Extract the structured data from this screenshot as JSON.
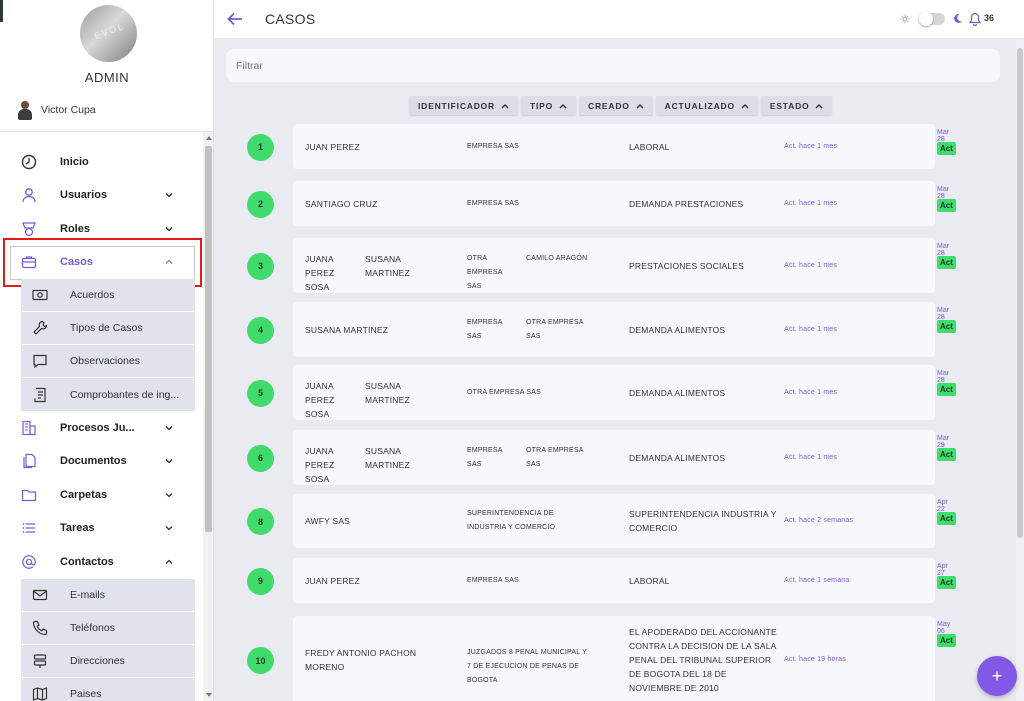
{
  "sidebar": {
    "role": "ADMIN",
    "avatar_text": "EVOL",
    "user_name": "Victor Cupa",
    "items": [
      {
        "label": "Inicio"
      },
      {
        "label": "Usuarios"
      },
      {
        "label": "Roles"
      },
      {
        "label": "Casos"
      },
      {
        "label": "Procesos Ju..."
      },
      {
        "label": "Documentos"
      },
      {
        "label": "Carpetas"
      },
      {
        "label": "Tareas"
      },
      {
        "label": "Contactos"
      }
    ],
    "casos_sub": [
      {
        "label": "Acuerdos"
      },
      {
        "label": "Tipos de Casos"
      },
      {
        "label": "Observaciones"
      },
      {
        "label": "Comprobantes de ing..."
      }
    ],
    "contactos_sub": [
      {
        "label": "E-mails"
      },
      {
        "label": "Teléfonos"
      },
      {
        "label": "Direcciones"
      },
      {
        "label": "Paises"
      }
    ]
  },
  "header": {
    "title": "CASOS",
    "notifications": "36"
  },
  "filter": {
    "placeholder": "Filtrar"
  },
  "sort": [
    {
      "label": "IDENTIFICADOR"
    },
    {
      "label": "TIPO"
    },
    {
      "label": "CREADO"
    },
    {
      "label": "ACTUALIZADO"
    },
    {
      "label": "ESTADO"
    }
  ],
  "cases": [
    {
      "num": "1",
      "names": [
        "JUAN PEREZ"
      ],
      "types": [
        "EMPRESA SAS"
      ],
      "desc": "LABORAL",
      "updated": "Act. hace 1 mes",
      "date": "Mar 28",
      "status": "Act"
    },
    {
      "num": "2",
      "names": [
        "SANTIAGO CRUZ"
      ],
      "types": [
        "EMPRESA SAS"
      ],
      "desc": "DEMANDA PRESTACIONES",
      "updated": "Act. hace 1 mes",
      "date": "Mar 28",
      "status": "Act"
    },
    {
      "num": "3",
      "names": [
        "JUANA PEREZ SOSA",
        "SUSANA MARTINEZ"
      ],
      "types": [
        "OTRA EMPRESA SAS",
        "CAMILO ARAGÓN"
      ],
      "desc": "PRESTACIONES SOCIALES",
      "updated": "Act. hace 1 mes",
      "date": "Mar 28",
      "status": "Act"
    },
    {
      "num": "4",
      "names": [
        "SUSANA MARTINEZ"
      ],
      "types": [
        "EMPRESA SAS",
        "OTRA EMPRESA SAS"
      ],
      "desc": "DEMANDA ALIMENTOS",
      "updated": "Act. hace 1 mes",
      "date": "Mar 28",
      "status": "Act"
    },
    {
      "num": "5",
      "names": [
        "JUANA PEREZ SOSA",
        "SUSANA MARTINEZ"
      ],
      "types": [
        "OTRA EMPRESA SAS"
      ],
      "desc": "DEMANDA ALIMENTOS",
      "updated": "Act. hace 1 mes",
      "date": "Mar 28",
      "status": "Act"
    },
    {
      "num": "6",
      "names": [
        "JUANA PEREZ SOSA",
        "SUSANA MARTINEZ"
      ],
      "types": [
        "EMPRESA SAS",
        "OTRA EMPRESA SAS"
      ],
      "desc": "DEMANDA ALIMENTOS",
      "updated": "Act. hace 1 mes",
      "date": "Mar 29",
      "status": "Act"
    },
    {
      "num": "8",
      "names": [
        "AWFY SAS"
      ],
      "types": [
        "SUPERINTENDENCIA DE INDUSTRIA Y COMERCIO"
      ],
      "desc": "SUPERINTENDENCIA INDUSTRIA Y COMERCIO",
      "updated": "Act. hace 2 semanas",
      "date": "Apr 22",
      "status": "Act"
    },
    {
      "num": "9",
      "names": [
        "JUAN PEREZ"
      ],
      "types": [
        "EMPRESA SAS"
      ],
      "desc": "LABORAL",
      "updated": "Act. hace 1 semana",
      "date": "Apr 27",
      "status": "Act"
    },
    {
      "num": "10",
      "names": [
        "FREDY ANTONIO PACHON MORENO"
      ],
      "types": [
        "JUZGADOS 8 PENAL MUNICIPAL Y 7 DE EJECUCION DE PENAS DE BOGOTA"
      ],
      "desc": "EL APODERADO DEL ACCIONANTE CONTRA LA DECISION DE LA SALA PENAL DEL TRIBUNAL SUPERIOR DE BOGOTA DEL 18 DE NOVIEMBRE DE 2010",
      "updated": "Act. hace 19 horas",
      "date": "May 06",
      "status": "Act"
    }
  ],
  "colors": {
    "accent": "#7a5ad6",
    "status_green": "#3fdc6c",
    "highlight_red": "#e01b1b"
  }
}
